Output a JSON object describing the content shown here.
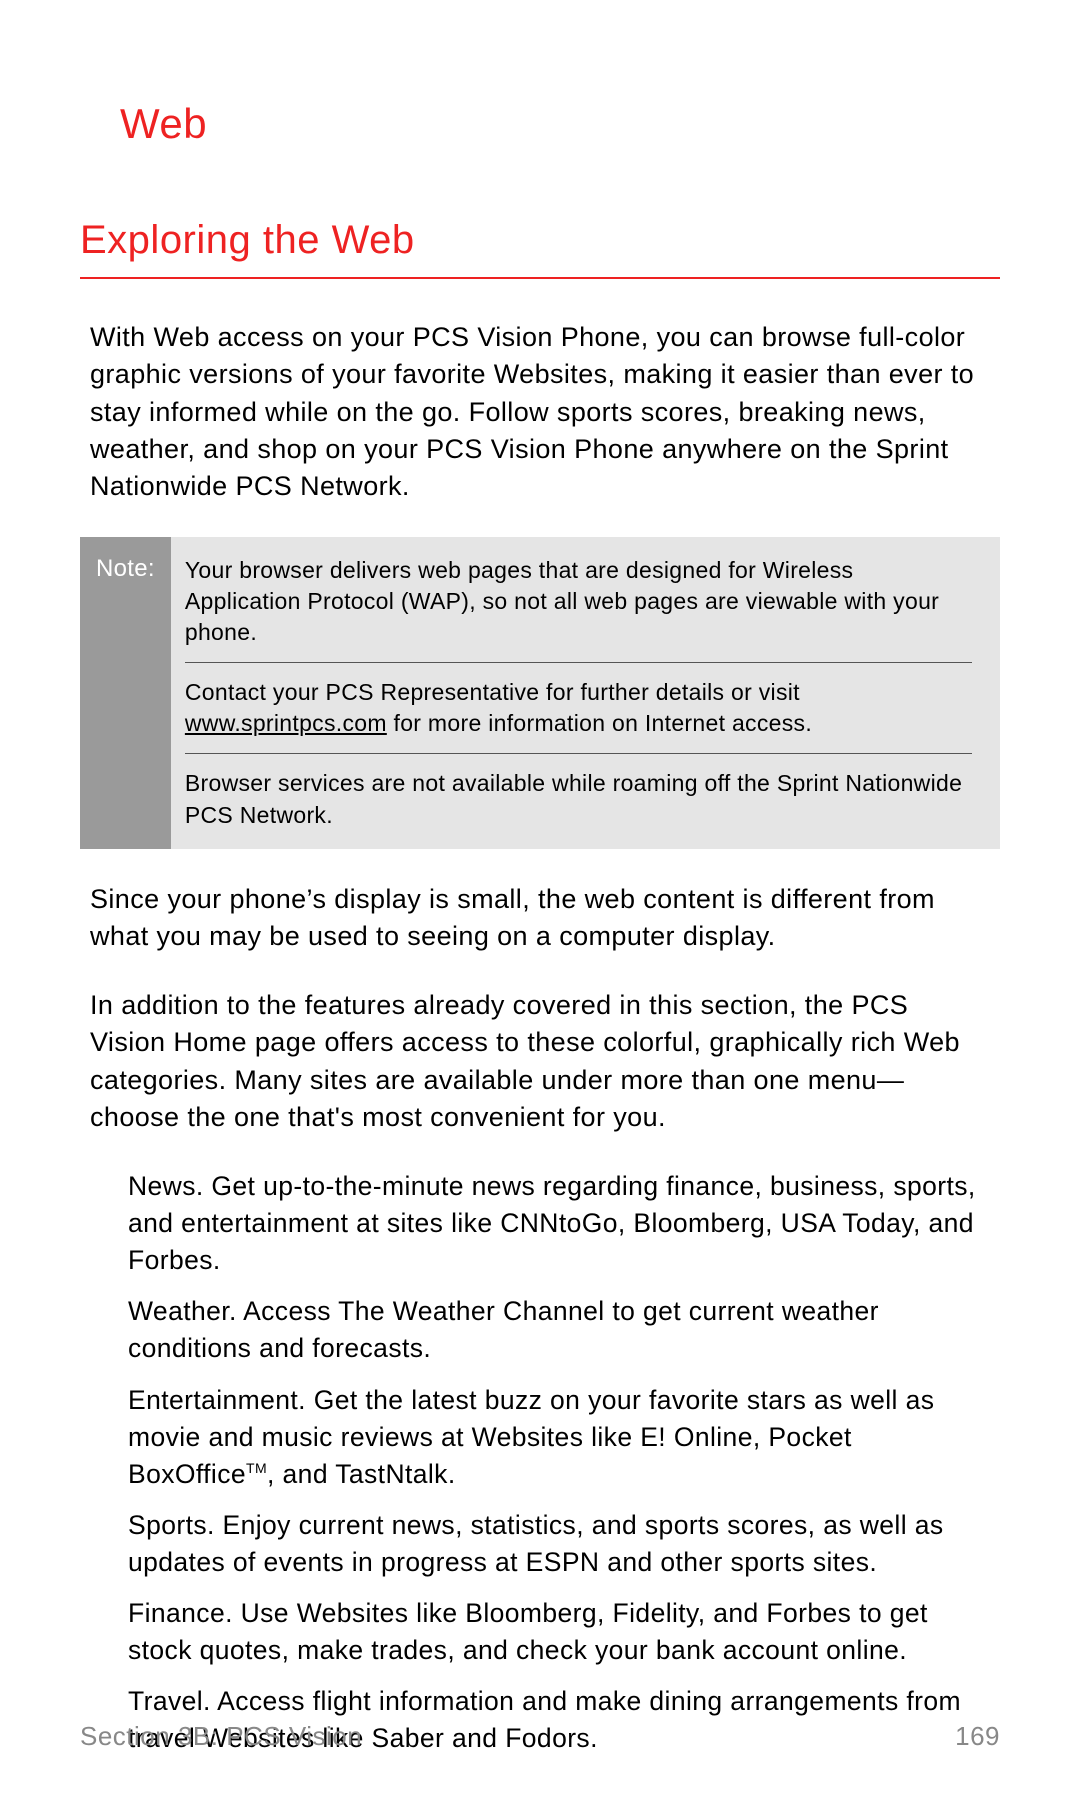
{
  "title": "Web",
  "heading": "Exploring the Web",
  "intro": "With Web access on your PCS Vision Phone, you can browse full-color graphic versions of your favorite Websites, making it easier than ever to stay informed while on the go. Follow sports scores, breaking news, weather, and shop on your PCS Vision Phone anywhere on the Sprint Nationwide PCS Network.",
  "note": {
    "label": "Note:",
    "p1": "Your browser delivers web pages that are designed for Wireless Application Protocol (WAP), so not all web pages are viewable with your phone.",
    "p2_pre": "Contact your PCS Representative for further details or visit ",
    "p2_link": "www.sprintpcs.com",
    "p2_post": " for more information on Internet access.",
    "p3": "Browser services are not available while roaming off the Sprint Nationwide PCS Network."
  },
  "para2": "Since your phone’s display is small, the web content is different from what you may be used to seeing on a computer display.",
  "para3": "In addition to the features already covered in this section, the PCS Vision Home page offers access to these colorful, graphically rich Web categories. Many sites are available under more than one menu—choose the one that's most convenient for you.",
  "categories": {
    "news_name": "News.",
    "news_body": " Get up-to-the-minute news regarding finance, business, sports, and entertainment at sites like CNNtoGo, Bloomberg, USA Today, and Forbes.",
    "weather_name": "Weather.",
    "weather_body": " Access The Weather Channel to get current weather conditions and forecasts.",
    "ent_name": "Entertainment.",
    "ent_body_pre": " Get the latest buzz on your favorite stars as well as movie and music reviews at Websites like E! Online, Pocket BoxOffice",
    "ent_tm": "TM",
    "ent_body_post": ", and TastNtalk.",
    "sports_name": "Sports.",
    "sports_body": " Enjoy current news, statistics, and sports scores, as well as updates of events in progress at ESPN and other sports sites.",
    "finance_name": "Finance.",
    "finance_body": " Use Websites like Bloomberg, Fidelity, and Forbes to get stock quotes, make trades, and check your bank account online.",
    "travel_name": "Travel.",
    "travel_body": " Access flight information and make dining arrangements from travel Websites like Saber and Fodors."
  },
  "footer": {
    "section": "Section 3B: PCS Vision",
    "page": "169"
  }
}
